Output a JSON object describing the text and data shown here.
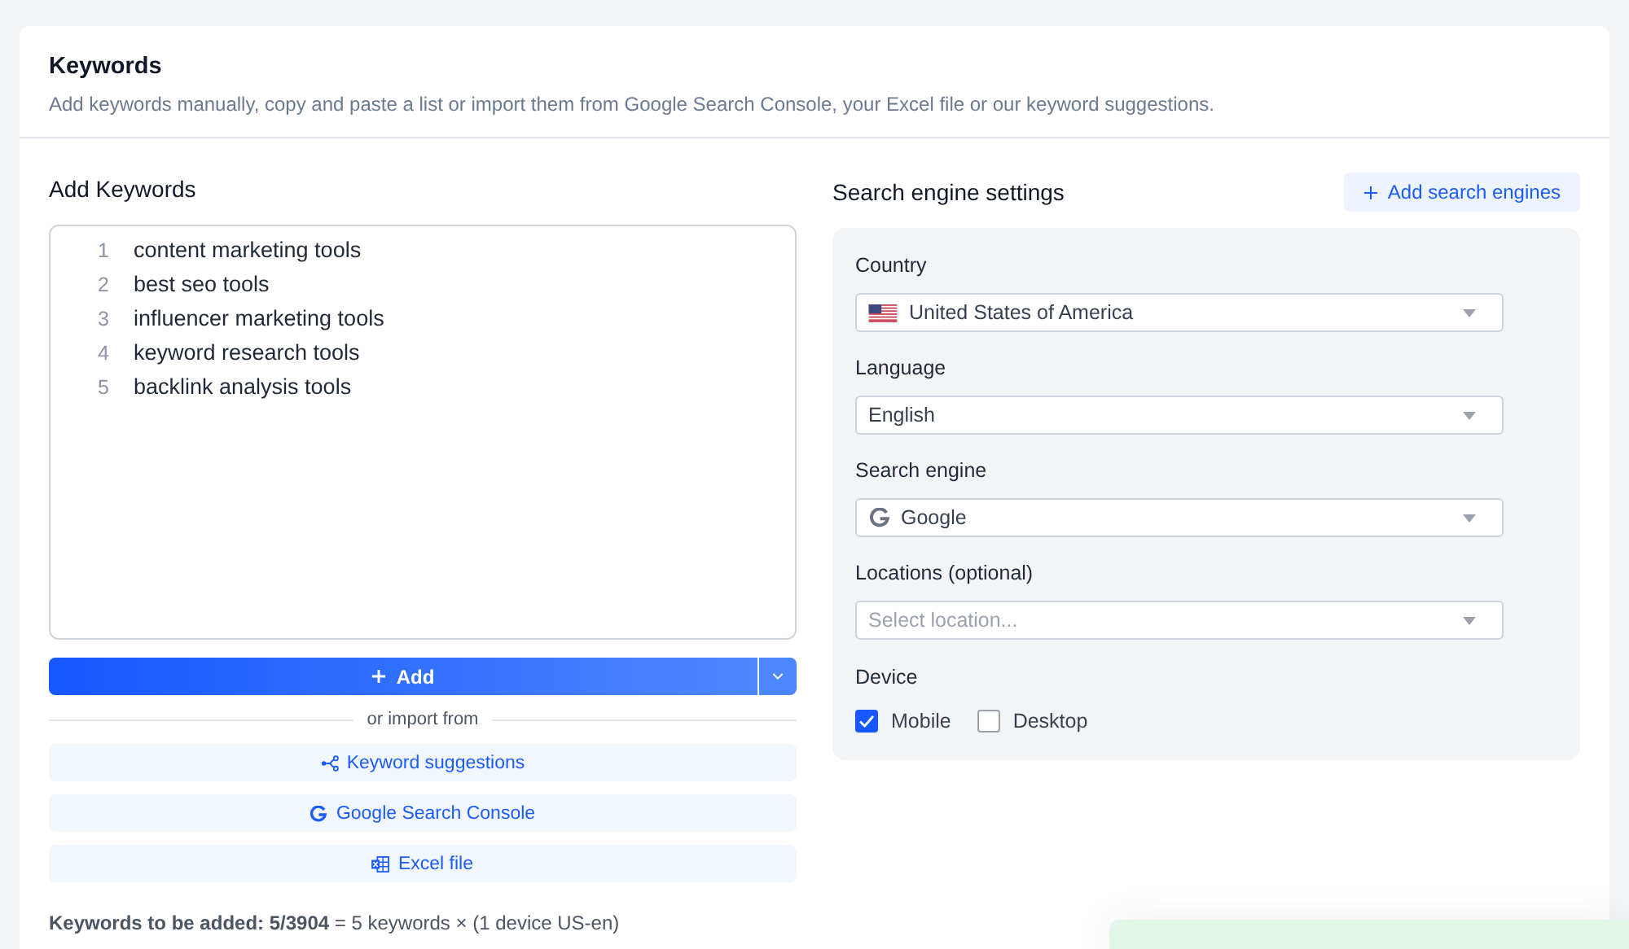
{
  "header": {
    "title": "Keywords",
    "subtitle": "Add keywords manually, copy and paste a list or import them from Google Search Console, your Excel file or our keyword suggestions."
  },
  "add_keywords": {
    "title": "Add Keywords",
    "lines": [
      {
        "number": "1",
        "text": "content marketing tools"
      },
      {
        "number": "2",
        "text": "best seo tools"
      },
      {
        "number": "3",
        "text": "influencer marketing tools"
      },
      {
        "number": "4",
        "text": "keyword research tools"
      },
      {
        "number": "5",
        "text": "backlink analysis tools"
      }
    ],
    "add_button": "Add",
    "divider_label": "or import from",
    "import_buttons": [
      {
        "kind": "suggestions",
        "label": "Keyword suggestions"
      },
      {
        "kind": "google",
        "label": "Google Search Console"
      },
      {
        "kind": "excel",
        "label": "Excel file"
      }
    ],
    "summary": "**Keywords to be added: 5/3904** = 5 keywords × (1 device US-en)"
  },
  "search_engine_settings": {
    "title": "Search engine settings",
    "add_button": "Add search engines",
    "fields": [
      {
        "kind": "country",
        "label": "Country",
        "value": "United States of America"
      },
      {
        "kind": "text",
        "label": "Language",
        "value": "English"
      },
      {
        "kind": "engine",
        "label": "Search engine",
        "value": "Google"
      },
      {
        "kind": "text",
        "label": "Locations (optional)",
        "placeholder": "Select location..."
      }
    ],
    "device": {
      "label": "Device",
      "options": [
        {
          "label": "Mobile",
          "checked": true
        },
        {
          "label": "Desktop",
          "checked": false
        }
      ]
    }
  },
  "toast": {
    "kind": "success"
  }
}
